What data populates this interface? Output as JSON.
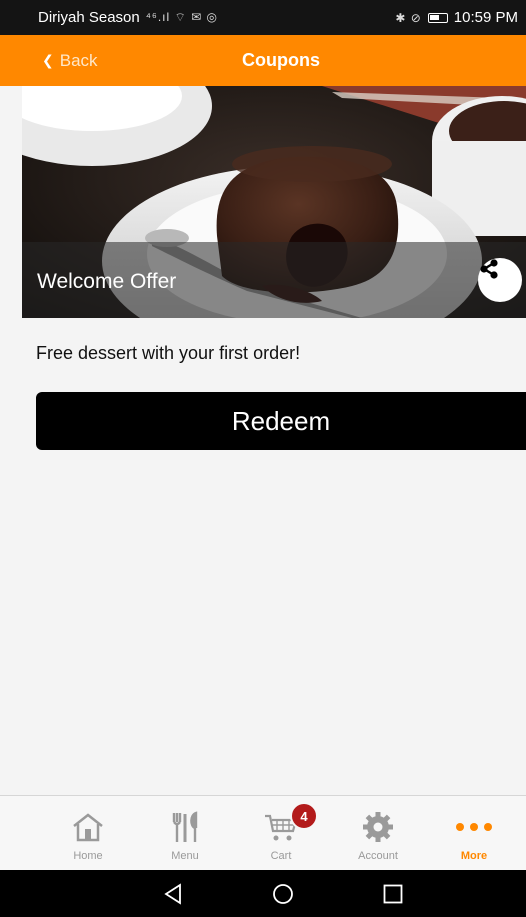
{
  "status_bar": {
    "carrier": "Diriyah Season",
    "left_icons": "⁴⁶.ıl ⌔ ✉ ◎",
    "time": "10:59 PM"
  },
  "header": {
    "back_label": "Back",
    "title": "Coupons",
    "color": "#ff8800"
  },
  "coupon": {
    "title": "Welcome Offer",
    "description": "Free dessert with your first order!",
    "redeem_label": "Redeem",
    "share_icon": "share-icon"
  },
  "tabs": [
    {
      "label": "Home",
      "icon": "home-icon"
    },
    {
      "label": "Menu",
      "icon": "cutlery-icon"
    },
    {
      "label": "Cart",
      "icon": "cart-icon",
      "badge": "4"
    },
    {
      "label": "Account",
      "icon": "gear-icon"
    },
    {
      "label": "More",
      "icon": "more-dots-icon",
      "active": true
    }
  ]
}
